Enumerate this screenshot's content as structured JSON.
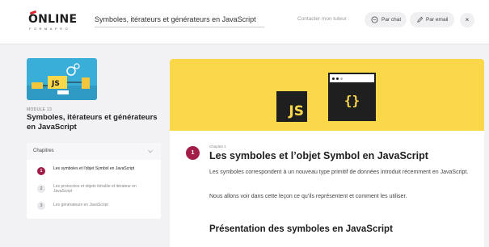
{
  "header": {
    "logo_word": "ONLINE",
    "logo_sub": "FORMAPRO",
    "lesson_title": "Symboles, itérateurs et générateurs en JavaScript",
    "contact_label": "Contacter mon tuteur :",
    "chat_label": "Par chat",
    "email_label": "Par email",
    "close_label": "×"
  },
  "sidebar": {
    "thumbnail_icon": "javascript-course-illustration",
    "module_label": "MODULE 13",
    "module_title": "Symboles, itérateurs et générateurs en JavaScript",
    "chapters_title": "Chapitres",
    "chapters": [
      {
        "number": "1",
        "label": "Les symboles et l'objet Symbol en JavaScript",
        "active": true
      },
      {
        "number": "2",
        "label": "Les protocoles et objets itérable et itérateur en JavaScript",
        "active": false
      },
      {
        "number": "3",
        "label": "Les générateurs en JavaScript",
        "active": false
      }
    ]
  },
  "content": {
    "banner": {
      "js_logo_text": "JS",
      "code_window_text": "{}"
    },
    "chapter_number": "1",
    "chapter_kicker": "Chapitre 1",
    "chapter_title": "Les symboles et l’objet Symbol en JavaScript",
    "paragraphs": [
      "Les symboles correspondent à un nouveau type primitif de données introduit récemment en JavaScript.",
      "Nous allons voir dans cette leçon ce qu’ils représentent et comment les utiliser."
    ],
    "section_title": "Présentation des symboles en JavaScript"
  },
  "colors": {
    "accent": "#a31d49",
    "brand_red": "#e0262f",
    "banner_yellow": "#fbd849",
    "thumbnail_blue": "#38aed9"
  }
}
